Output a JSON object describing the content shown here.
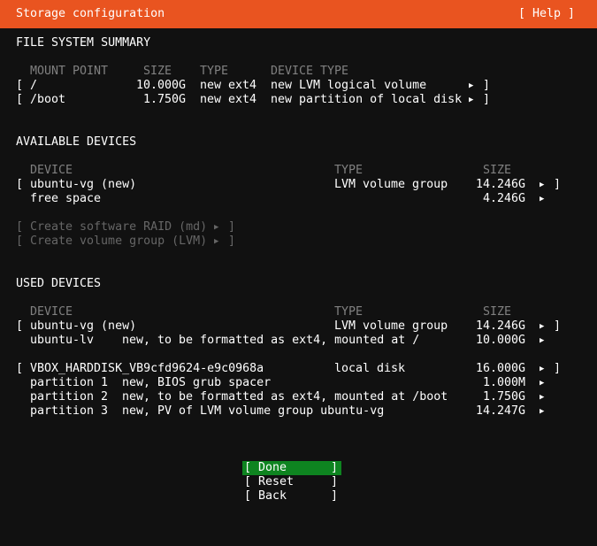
{
  "header": {
    "title": "Storage configuration",
    "help_label": "[ Help ]"
  },
  "colors": {
    "accent": "#e95420",
    "focus": "#0e8420",
    "background": "#111111"
  },
  "fs_summary": {
    "title": "FILE SYSTEM SUMMARY",
    "columns": [
      "MOUNT POINT",
      "SIZE",
      "TYPE",
      "DEVICE TYPE"
    ],
    "rows": [
      {
        "mount": "/",
        "size": "10.000G",
        "type": "new ext4",
        "device_type": "new LVM logical volume"
      },
      {
        "mount": "/boot",
        "size": "1.750G",
        "type": "new ext4",
        "device_type": "new partition of local disk"
      }
    ]
  },
  "available": {
    "title": "AVAILABLE DEVICES",
    "columns": [
      "DEVICE",
      "TYPE",
      "SIZE"
    ],
    "rows": [
      {
        "device": "ubuntu-vg (new)",
        "type": "LVM volume group",
        "size": "14.246G"
      },
      {
        "device": "free space",
        "type": "",
        "size": "4.246G"
      }
    ],
    "actions": [
      {
        "label": "Create software RAID (md)"
      },
      {
        "label": "Create volume group (LVM)"
      }
    ]
  },
  "used": {
    "title": "USED DEVICES",
    "columns": [
      "DEVICE",
      "TYPE",
      "SIZE"
    ],
    "groups": [
      {
        "device": "ubuntu-vg (new)",
        "type": "LVM volume group",
        "size": "14.246G",
        "children": [
          {
            "name": "ubuntu-lv",
            "desc": "new, to be formatted as ext4, mounted at /",
            "size": "10.000G"
          }
        ]
      },
      {
        "device": "VBOX_HARDDISK_VB9cfd9624-e9c0968a",
        "type": "local disk",
        "size": "16.000G",
        "children": [
          {
            "name": "partition 1",
            "desc": "new, BIOS grub spacer",
            "size": "1.000M"
          },
          {
            "name": "partition 2",
            "desc": "new, to be formatted as ext4, mounted at /boot",
            "size": "1.750G"
          },
          {
            "name": "partition 3",
            "desc": "new, PV of LVM volume group ubuntu-vg",
            "size": "14.247G"
          }
        ]
      }
    ]
  },
  "buttons": {
    "done": "Done",
    "reset": "Reset",
    "back": "Back"
  },
  "glyphs": {
    "arrow": "▶",
    "lbracket": "[",
    "rbracket": "]"
  }
}
